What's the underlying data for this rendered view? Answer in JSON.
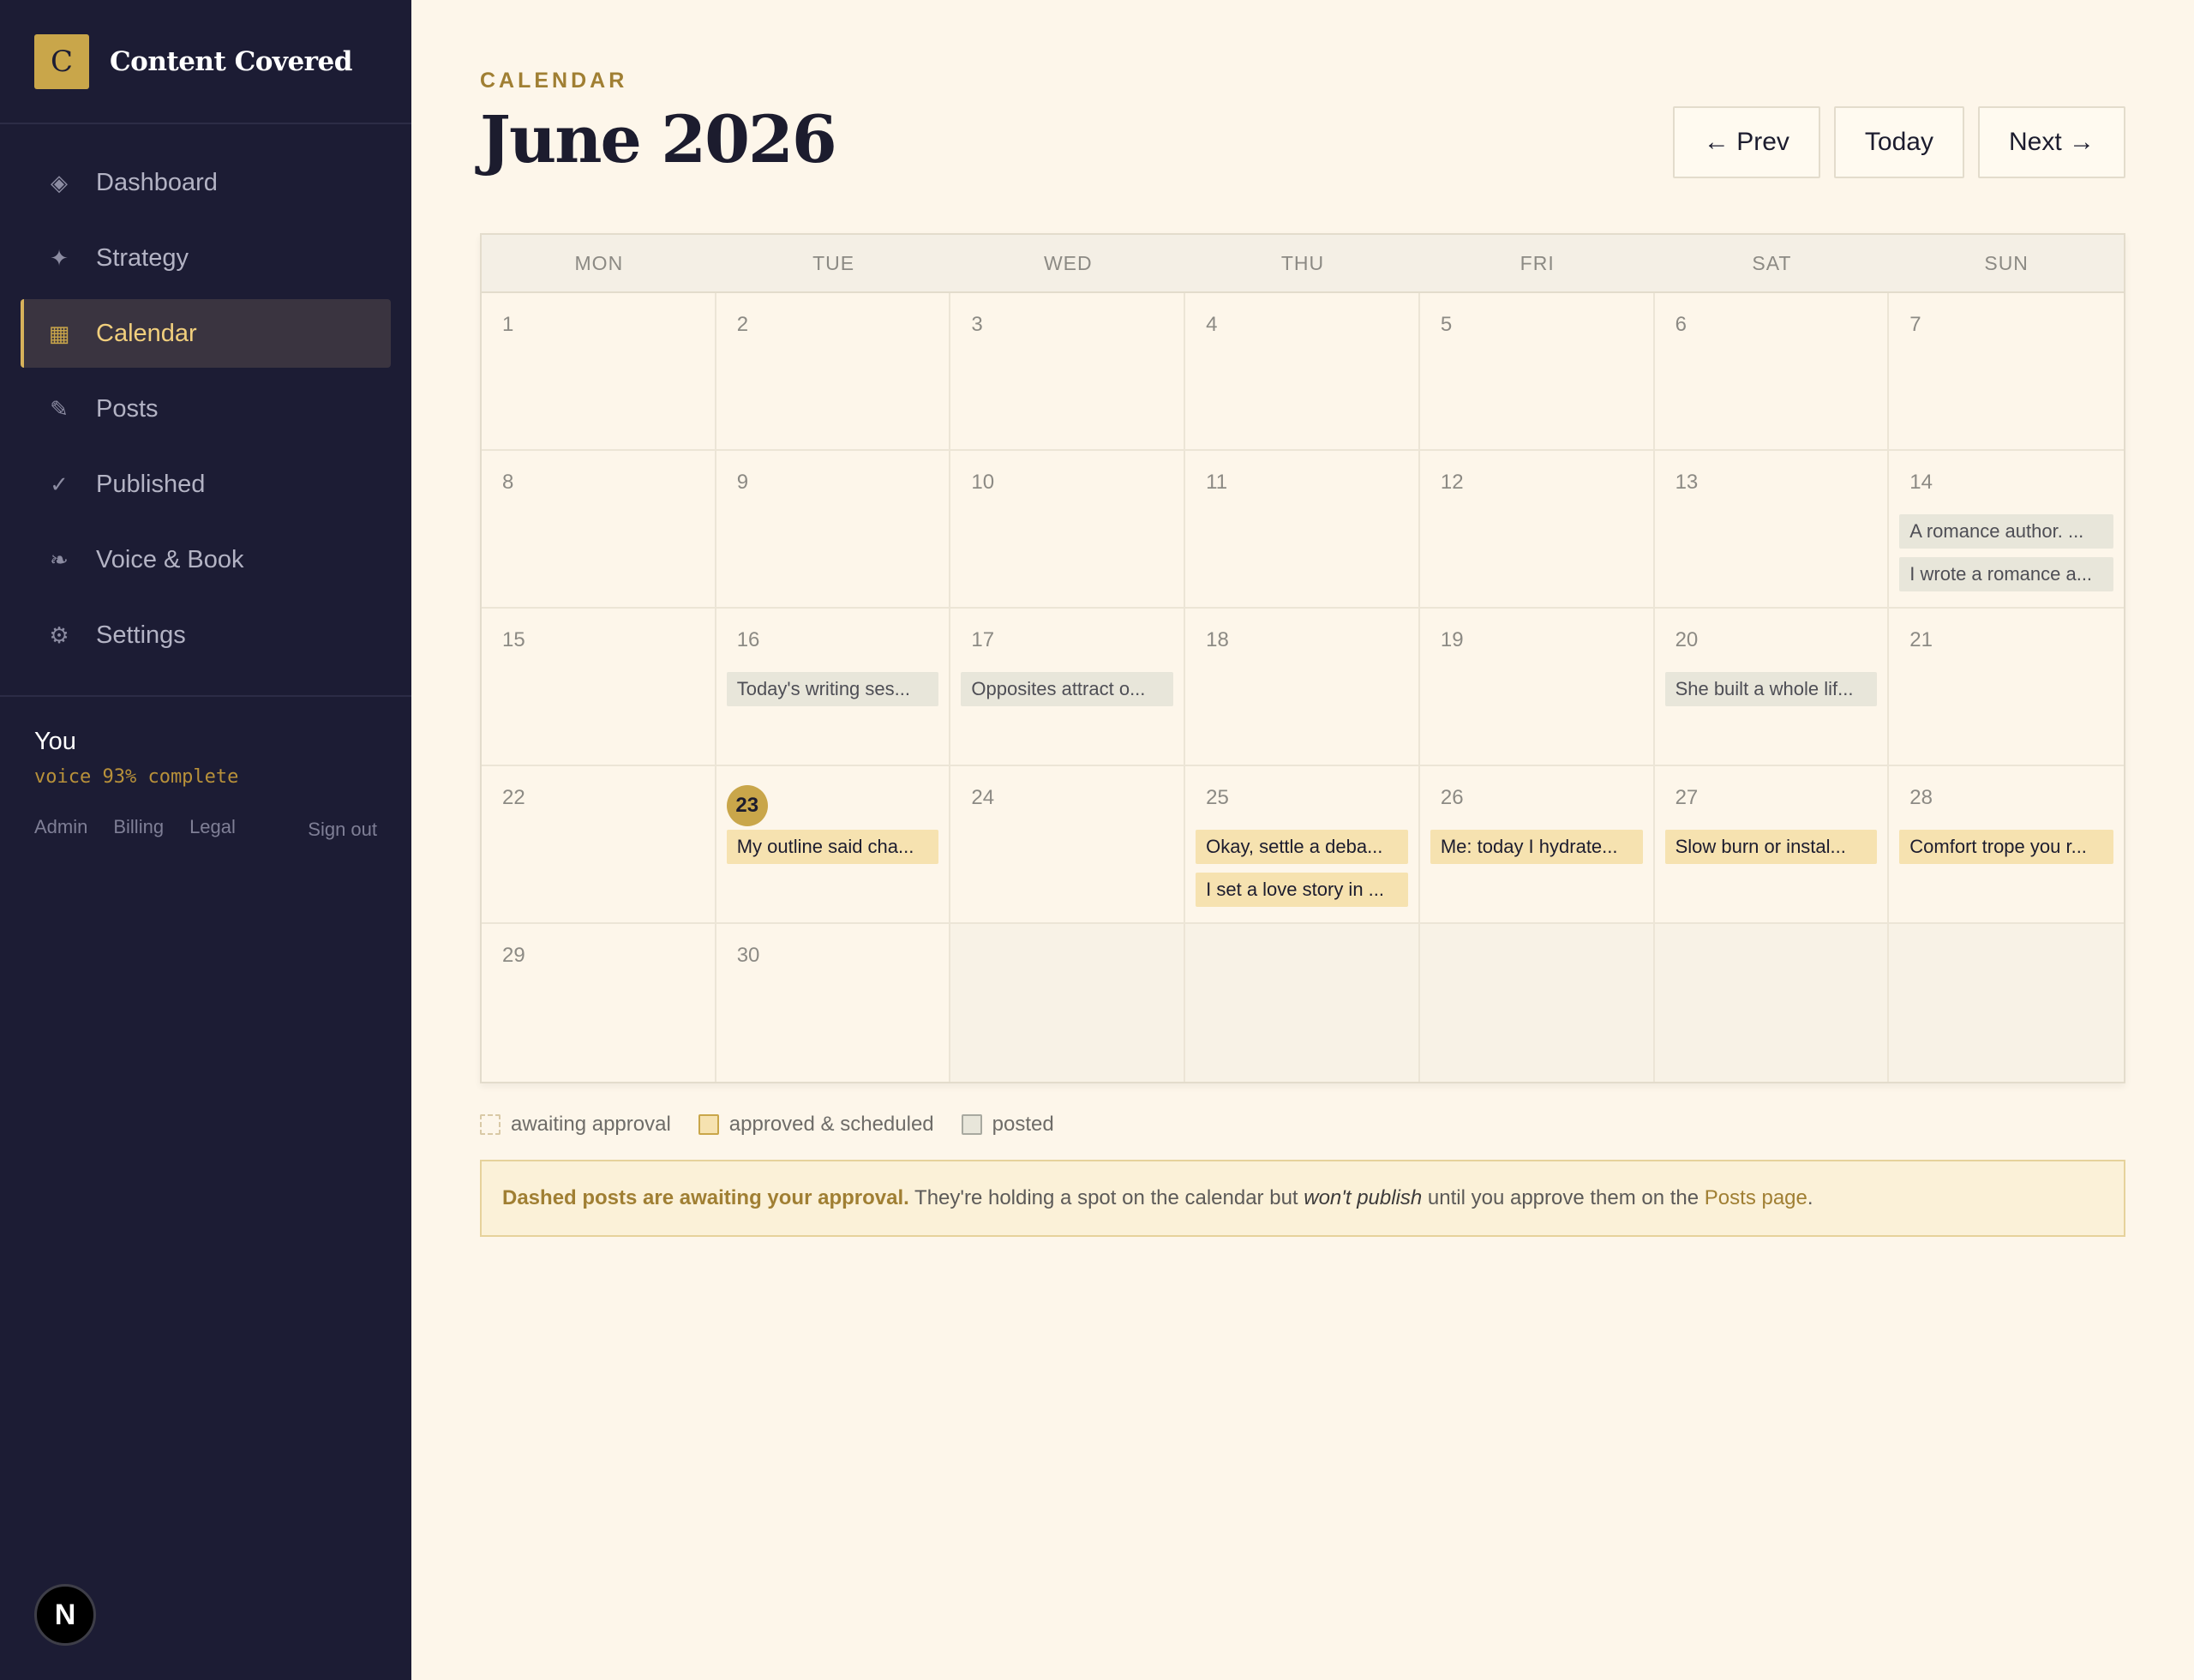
{
  "brand": {
    "logo_letter": "C",
    "name": "Content Covered"
  },
  "sidebar": {
    "items": [
      {
        "icon": "diamond-icon",
        "glyph": "◈",
        "label": "Dashboard",
        "active": false
      },
      {
        "icon": "sparkle-icon",
        "glyph": "✦",
        "label": "Strategy",
        "active": false
      },
      {
        "icon": "calendar-icon",
        "glyph": "▦",
        "label": "Calendar",
        "active": true
      },
      {
        "icon": "pencil-icon",
        "glyph": "✎",
        "label": "Posts",
        "active": false
      },
      {
        "icon": "check-icon",
        "glyph": "✓",
        "label": "Published",
        "active": false
      },
      {
        "icon": "flourish-icon",
        "glyph": "❧",
        "label": "Voice & Book",
        "active": false
      },
      {
        "icon": "gear-icon",
        "glyph": "⚙",
        "label": "Settings",
        "active": false
      }
    ],
    "user": {
      "name": "You",
      "voice_status": "voice 93% complete"
    },
    "footer_links": [
      "Admin",
      "Billing",
      "Legal"
    ],
    "sign_out": "Sign out",
    "badge": "N"
  },
  "header": {
    "eyebrow": "CALENDAR",
    "title": "June 2026",
    "prev_label": "← Prev",
    "today_label": "Today",
    "next_label": "Next →"
  },
  "calendar": {
    "weekdays": [
      "MON",
      "TUE",
      "WED",
      "THU",
      "FRI",
      "SAT",
      "SUN"
    ],
    "today": 23,
    "days": [
      {
        "day": "1",
        "posts": []
      },
      {
        "day": "2",
        "posts": []
      },
      {
        "day": "3",
        "posts": []
      },
      {
        "day": "4",
        "posts": []
      },
      {
        "day": "5",
        "posts": []
      },
      {
        "day": "6",
        "posts": []
      },
      {
        "day": "7",
        "posts": []
      },
      {
        "day": "8",
        "posts": []
      },
      {
        "day": "9",
        "posts": []
      },
      {
        "day": "10",
        "posts": []
      },
      {
        "day": "11",
        "posts": []
      },
      {
        "day": "12",
        "posts": []
      },
      {
        "day": "13",
        "posts": []
      },
      {
        "day": "14",
        "posts": [
          {
            "text": "A romance author. ...",
            "status": "posted"
          },
          {
            "text": "I wrote a romance a...",
            "status": "posted"
          }
        ]
      },
      {
        "day": "15",
        "posts": []
      },
      {
        "day": "16",
        "posts": [
          {
            "text": "Today's writing ses...",
            "status": "posted"
          }
        ]
      },
      {
        "day": "17",
        "posts": [
          {
            "text": "Opposites attract o...",
            "status": "posted"
          }
        ]
      },
      {
        "day": "18",
        "posts": []
      },
      {
        "day": "19",
        "posts": []
      },
      {
        "day": "20",
        "posts": [
          {
            "text": "She built a whole lif...",
            "status": "posted"
          }
        ]
      },
      {
        "day": "21",
        "posts": []
      },
      {
        "day": "22",
        "posts": []
      },
      {
        "day": "23",
        "posts": [
          {
            "text": "My outline said cha...",
            "status": "approved"
          }
        ]
      },
      {
        "day": "24",
        "posts": []
      },
      {
        "day": "25",
        "posts": [
          {
            "text": "Okay, settle a deba...",
            "status": "approved"
          },
          {
            "text": "I set a love story in ...",
            "status": "approved"
          }
        ]
      },
      {
        "day": "26",
        "posts": [
          {
            "text": "Me: today I hydrate...",
            "status": "approved"
          }
        ]
      },
      {
        "day": "27",
        "posts": [
          {
            "text": "Slow burn or instal...",
            "status": "approved"
          }
        ]
      },
      {
        "day": "28",
        "posts": [
          {
            "text": "Comfort trope you r...",
            "status": "approved"
          }
        ]
      },
      {
        "day": "29",
        "posts": []
      },
      {
        "day": "30",
        "posts": []
      },
      {
        "day": "",
        "posts": []
      },
      {
        "day": "",
        "posts": []
      },
      {
        "day": "",
        "posts": []
      },
      {
        "day": "",
        "posts": []
      },
      {
        "day": "",
        "posts": []
      }
    ]
  },
  "legend": {
    "awaiting": "awaiting approval",
    "approved": "approved & scheduled",
    "posted": "posted"
  },
  "notice": {
    "strong": "Dashed posts are awaiting your approval.",
    "text_1": " They're holding a spot on the calendar but ",
    "emphasis": "won't publish",
    "text_2": " until you approve them on the ",
    "link": "Posts page",
    "text_3": "."
  },
  "colors": {
    "sidebar_bg": "#1c1c34",
    "accent_gold": "#c9a64a",
    "page_bg": "#fdf6ea",
    "approved_bg": "#f6e2b0",
    "posted_bg": "#e8e6da"
  }
}
